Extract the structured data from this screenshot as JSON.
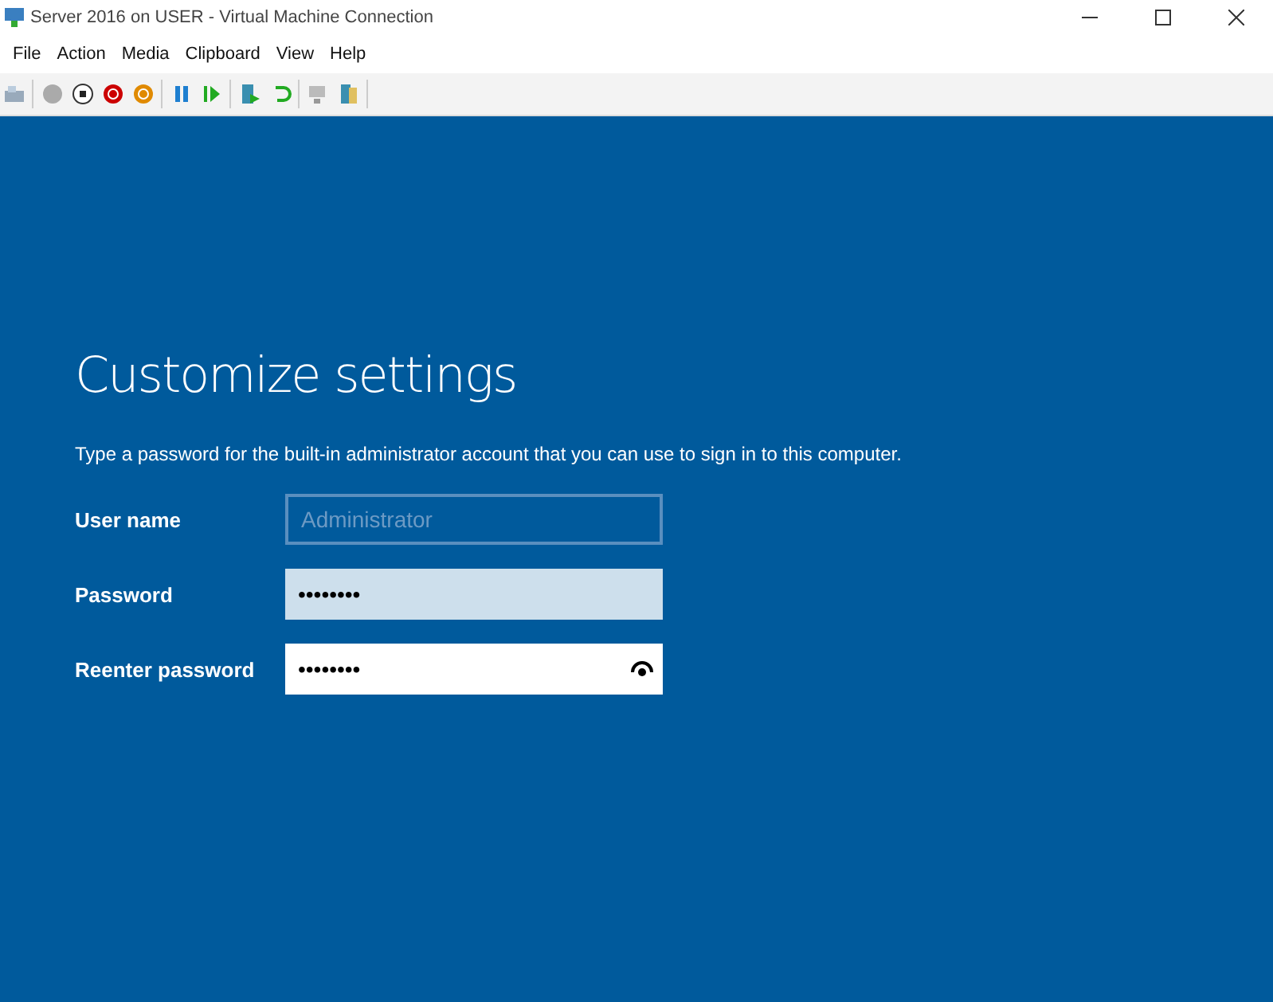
{
  "window": {
    "title": "Server 2016 on USER - Virtual Machine Connection"
  },
  "menu": [
    "File",
    "Action",
    "Media",
    "Clipboard",
    "View",
    "Help"
  ],
  "setup": {
    "heading": "Customize settings",
    "description": "Type a password for the built-in administrator account that you can use to sign in to this computer.",
    "fields": [
      {
        "label": "User name",
        "placeholder": "Administrator",
        "disabled": true,
        "focused": false
      },
      {
        "label": "Password",
        "value": "••••••••",
        "disabled": false,
        "focused": false
      },
      {
        "label": "Reenter password",
        "value": "••••••••",
        "disabled": false,
        "focused": true,
        "reveal": true
      }
    ]
  }
}
